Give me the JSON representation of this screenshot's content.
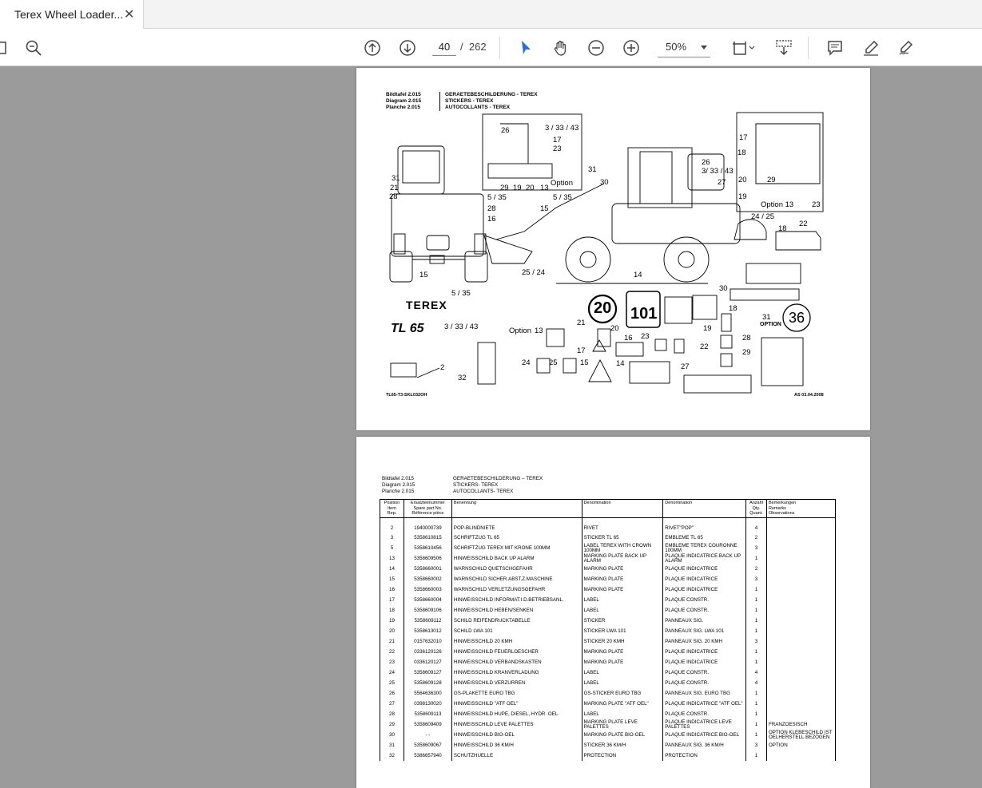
{
  "tab": {
    "title": "Terex Wheel Loader...",
    "close": "✕"
  },
  "toolbar": {
    "page_current": "40",
    "page_sep": "/",
    "page_total": "262",
    "zoom": "50%"
  },
  "page1": {
    "header_left": [
      "Bildtafel  2.015",
      "Diagram   2.015",
      "Planche   2.015"
    ],
    "header_right": [
      "GERAETEBESCHILDERUNG - TEREX",
      "STICKERS - TEREX",
      "AUTOCOLLANTS - TEREX"
    ],
    "footer_left": "TL65-T3-SKL032OH",
    "footer_right": "AS 03.04.2008",
    "callouts": [
      "26",
      "3 / 33 / 43",
      "17",
      "23",
      "29",
      "19",
      "20",
      "13",
      "Option",
      "31",
      "21",
      "28",
      "5 / 35",
      "28",
      "16",
      "15",
      "15",
      "25 / 24",
      "31",
      "30",
      "5 / 35",
      "26",
      "3/ 33 / 43",
      "27",
      "24 / 25",
      "14",
      "17",
      "18",
      "20",
      "29",
      "19",
      "Option 13",
      "23",
      "18",
      "22",
      "5 / 35",
      "3 / 33 / 43",
      "Option",
      "13",
      "20",
      "21",
      "20",
      "19",
      "18",
      "30",
      "31",
      "OPTION",
      "36",
      "17",
      "16",
      "23",
      "22",
      "28",
      "29",
      "24",
      "25",
      "15",
      "14",
      "27",
      "32",
      "2",
      "101",
      "TEREX",
      "TL 65"
    ]
  },
  "page2": {
    "header_left": [
      "Bildtafel    2.015",
      "Diagram     2.015",
      "Planche     2.015"
    ],
    "header_right": [
      "GERAETEBESCHILDERUNG – TEREX",
      "STICKERS- TEREX",
      "AUTOCOLLANTS- TEREX"
    ],
    "columns": [
      "Position\nItem\nRep.",
      "Ersatzteilnummer\nSpare part No.\nRéférence pièce",
      "Benennung",
      "Denomination",
      "Dénomination",
      "Anzahl\nQty.\nQuant.",
      "Bemerkungen\nRemarks\nObservations"
    ],
    "rows": [
      [
        "2",
        "1940000739",
        "POP-BLINDNIETE",
        "RIVET",
        "RIVET\"POP\"",
        "4",
        ""
      ],
      [
        "3",
        "5358610815",
        "SCHRIFTZUG TL 65",
        "STICKER TL 65",
        "EMBLEME TL 65",
        "2",
        ""
      ],
      [
        "5",
        "5358610456",
        "SCHRIFTZUG TEREX MIT KRONE 100MM",
        "LABEL TEREX WITH CROWN 100MM",
        "EMBLEME TEREX COURONNE 100MM",
        "3",
        ""
      ],
      [
        "13",
        "5358609506",
        "HINWEISSCHILD BACK UP ALARM",
        "MARKING PLATE BACK UP ALARM",
        "PLAQUE INDICATRICE BACK UP ALARM",
        "1",
        ""
      ],
      [
        "14",
        "5358660001",
        "WARNSCHILD QUETSCHGEFAHR",
        "MARKING PLATE",
        "PLAQUE INDICATRICE",
        "2",
        ""
      ],
      [
        "15",
        "5358660002",
        "WARNSCHILD SICHER.ABST.Z.MASCHINE",
        "MARKING PLATE",
        "PLAQUE INDICATRICE",
        "3",
        ""
      ],
      [
        "16",
        "5358660003",
        "WARNSCHILD VERLETZUNGSGEFAHR",
        "MARKING PLATE",
        "PLAQUE INDICATRICE",
        "1",
        ""
      ],
      [
        "17",
        "5358660004",
        "HINWEISSCHILD INFORMAT.I.D.BETRIEBSANL.",
        "LABEL",
        "PLAQUE CONSTR.",
        "1",
        ""
      ],
      [
        "18",
        "5358609106",
        "HINWEISSCHILD HEBEN/SENKEN",
        "LABEL",
        "PLAQUE CONSTR.",
        "1",
        ""
      ],
      [
        "19",
        "5358609112",
        "SCHILD REIFENDRUCKTABELLE",
        "STICKER",
        "PANNEAUX SIG.",
        "1",
        ""
      ],
      [
        "20",
        "5358613012",
        "SCHILD LWA 101",
        "STICKER LWA 101",
        "PANNEAUX SIG. LWA 101",
        "1",
        ""
      ],
      [
        "21",
        "0157632010",
        "HINWEISSCHILD 20 KMH",
        "STICKER 20 KMH",
        "PANNEAUX SIG. 20 KMH",
        "3",
        ""
      ],
      [
        "22",
        "0336120126",
        "HINWEISSCHILD FEUERLOESCHER",
        "MARKING PLATE",
        "PLAQUE INDICATRICE",
        "1",
        ""
      ],
      [
        "23",
        "0336120127",
        "HINWEISSCHILD VERBANDSKASTEN",
        "MARKING PLATE",
        "PLAQUE INDICATRICE",
        "1",
        ""
      ],
      [
        "24",
        "5358609127",
        "HINWEISSCHILD KRANVERLADUNG",
        "LABEL",
        "PLAQUE CONSTR.",
        "4",
        ""
      ],
      [
        "25",
        "5358609128",
        "HINWEISSCHILD VERZURREN",
        "LABEL",
        "PLAQUE CONSTR.",
        "4",
        ""
      ],
      [
        "26",
        "5564636300",
        "GS-PLAKETTE EURO TBG",
        "GS-STICKER EURO TBG",
        "PANNEAUX SIG. EURO TBG",
        "1",
        ""
      ],
      [
        "27",
        "0398130020",
        "HINWEISSCHILD \"ATF OEL\"",
        "MARKING PLATE \"ATF OEL\"",
        "PLAQUE INDICATRICE \"ATF OEL\"",
        "1",
        ""
      ],
      [
        "28",
        "5358609113",
        "HINWEISSCHILD HUPE, DIESEL, HYDR. OEL",
        "LABEL",
        "PLAQUE CONSTR.",
        "1",
        ""
      ],
      [
        "29",
        "5358609409",
        "HINWEISSCHILD LEVE PALETTES",
        "MARKING PLATE LEVE PALETTES",
        "PLAQUE INDICATRICE LEVE PALETTES",
        "1",
        "FRANZOESISCH"
      ],
      [
        "30",
        "- -",
        "HINWEISSCHILD BIO-OEL",
        "MARKING PLATE BIO-OEL",
        "PLAQUE INDICATRICE BIO-OEL",
        "1",
        "OPTION KLEBESCHILD IST OELHERSTELL.BEZOGEN"
      ],
      [
        "31",
        "5358609067",
        "HINWEISSCHILD 36 KM/H",
        "STICKER 36 KM/H",
        "PANNEAUX SIG. 36 KM/H",
        "3",
        "OPTION"
      ],
      [
        "32",
        "5386657940",
        "SCHUTZHUELLE",
        "PROTECTION",
        "PROTECTION",
        "1",
        ""
      ]
    ]
  }
}
